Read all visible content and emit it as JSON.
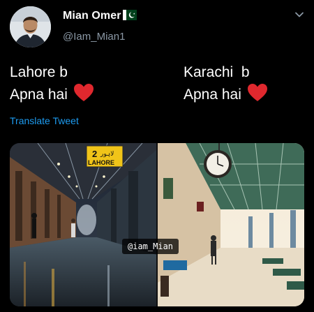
{
  "tweet": {
    "author": {
      "display_name": "Mian Omer",
      "handle": "@Iam_Mian1",
      "flag_icon": "pakistan-flag-icon"
    },
    "text_left": {
      "line1": "Lahore b",
      "line2": "Apna hai"
    },
    "text_right": {
      "line1": "Karachi  b",
      "line2": "Apna hai"
    },
    "emoji": "red-heart-icon",
    "translate_label": "Translate Tweet",
    "media": {
      "left_sign_number": "2",
      "left_sign_urdu": "لاہور",
      "left_sign_text": "LAHORE",
      "watermark": "@iam_Mian"
    }
  },
  "colors": {
    "background": "#000000",
    "text": "#ffffff",
    "secondary_text": "#8b98a5",
    "link": "#1d9bf0",
    "heart": "#e0282e"
  }
}
